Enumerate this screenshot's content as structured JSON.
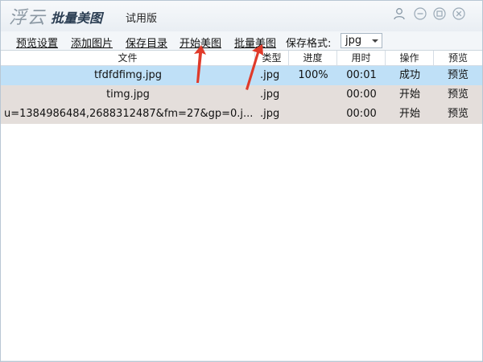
{
  "titlebar": {
    "logo_text": "浮云",
    "app_name": "批量美图",
    "edition": "试用版",
    "buttons": [
      "user-icon",
      "minimize-icon",
      "maximize-icon",
      "close-icon"
    ]
  },
  "menu": {
    "preview_settings": "预览设置",
    "add_images": "添加图片",
    "save_dir": "保存目录",
    "start_beautify": "开始美图",
    "batch_beautify": "批量美图",
    "format_label": "保存格式:",
    "format_value": "jpg"
  },
  "table": {
    "headers": {
      "file": "文件",
      "type": "类型",
      "progress": "进度",
      "time": "用时",
      "action": "操作",
      "preview": "预览"
    },
    "rows": [
      {
        "file": "tfdfdfimg.jpg",
        "type": ".jpg",
        "progress": "100%",
        "time": "00:01",
        "action": "成功",
        "preview": "预览"
      },
      {
        "file": "timg.jpg",
        "type": ".jpg",
        "progress": "",
        "time": "00:00",
        "action": "开始",
        "preview": "预览"
      },
      {
        "file": "u=1384986484,2688312487&fm=27&gp=0.j...",
        "type": ".jpg",
        "progress": "",
        "time": "00:00",
        "action": "开始",
        "preview": "预览"
      }
    ]
  },
  "colors": {
    "selected_row": "#bfe0f7",
    "normal_row": "#e4dedb",
    "annotation_arrow": "#e03a2a"
  }
}
